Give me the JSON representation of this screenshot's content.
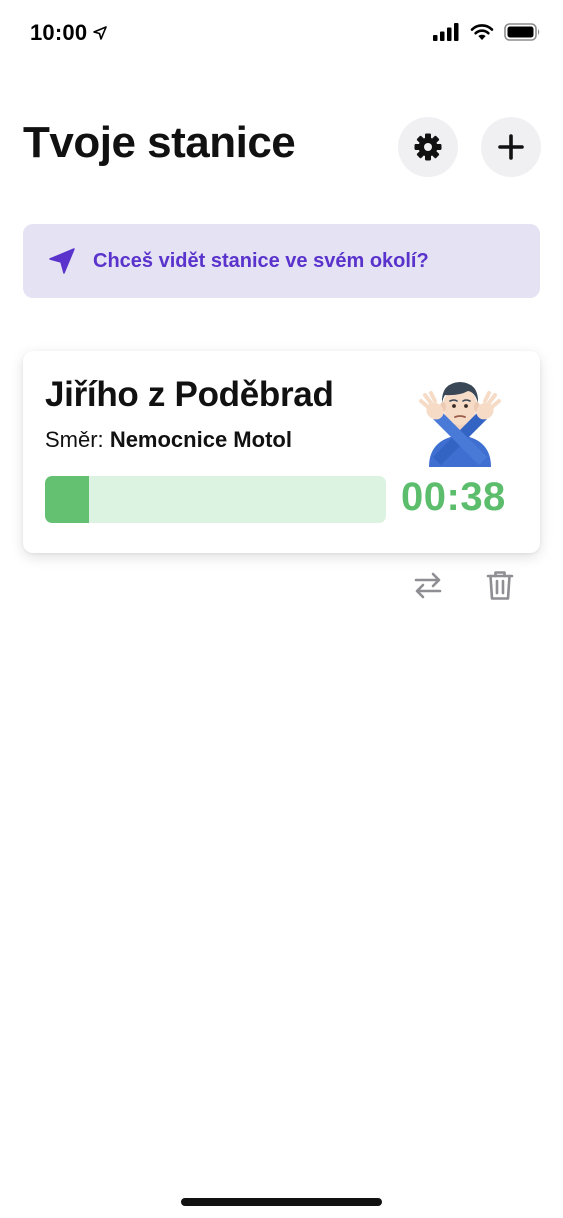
{
  "status_bar": {
    "time": "10:00",
    "icons": [
      "location-arrow-icon",
      "signal-icon",
      "wifi-icon",
      "battery-icon"
    ]
  },
  "header": {
    "title": "Tvoje stanice",
    "settings_icon": "gear-icon",
    "add_icon": "plus-icon"
  },
  "location_banner": {
    "icon": "location-arrow-icon",
    "text": "Chceš vidět stanice ve svém okolí?",
    "color": "#5a33cc",
    "background": "#e4e2f3"
  },
  "station": {
    "name": "Jiřího z Poděbrad",
    "direction_label": "Směr:",
    "direction_value": "Nemocnice Motol",
    "emoji": "🙅‍♂️",
    "progress_fraction": 0.13,
    "countdown": "00:38",
    "accent_color": "#5cbd6c"
  },
  "card_actions": {
    "swap_icon": "swap-arrows-icon",
    "delete_icon": "trash-icon"
  }
}
